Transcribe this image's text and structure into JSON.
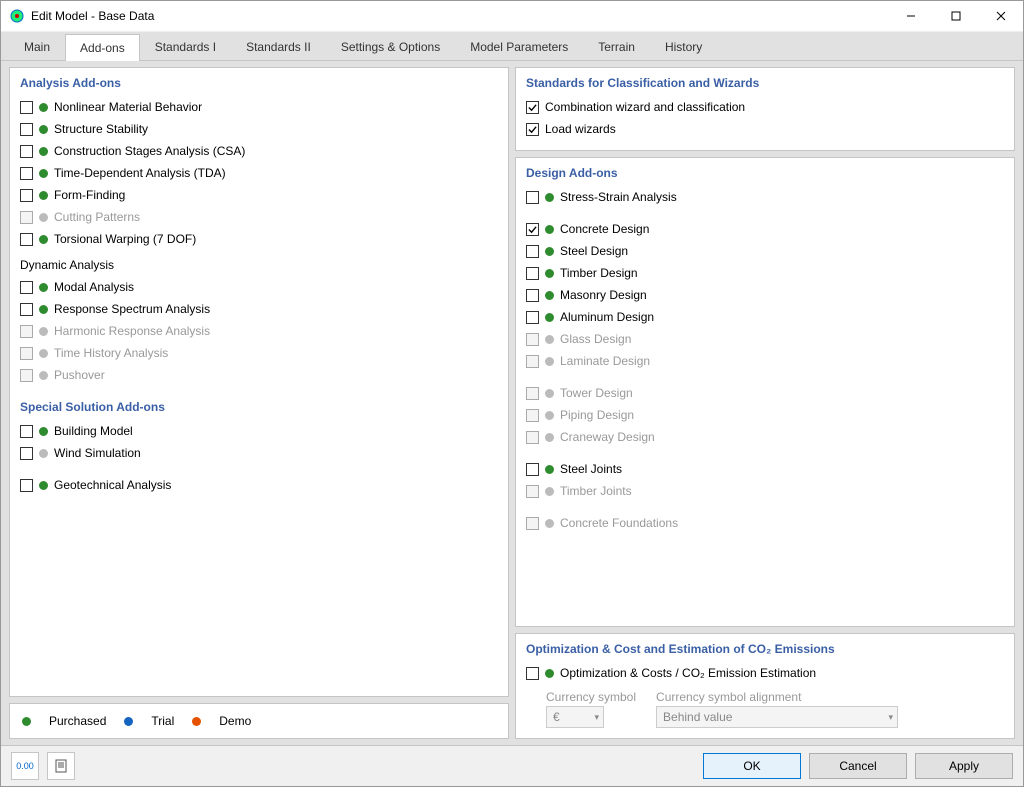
{
  "window": {
    "title": "Edit Model - Base Data"
  },
  "tabs": {
    "t0": "Main",
    "t1": "Add-ons",
    "t2": "Standards I",
    "t3": "Standards II",
    "t4": "Settings & Options",
    "t5": "Model Parameters",
    "t6": "Terrain",
    "t7": "History"
  },
  "sections": {
    "analysis": "Analysis Add-ons",
    "dynamic": "Dynamic Analysis",
    "special": "Special Solution Add-ons",
    "standards_wiz": "Standards for Classification and Wizards",
    "design": "Design Add-ons",
    "optimization": "Optimization & Cost and Estimation of CO₂ Emissions"
  },
  "analysis": {
    "i0": "Nonlinear Material Behavior",
    "i1": "Structure Stability",
    "i2": "Construction Stages Analysis (CSA)",
    "i3": "Time-Dependent Analysis (TDA)",
    "i4": "Form-Finding",
    "i5": "Cutting Patterns",
    "i6": "Torsional Warping (7 DOF)"
  },
  "dynamic": {
    "i0": "Modal Analysis",
    "i1": "Response Spectrum Analysis",
    "i2": "Harmonic Response Analysis",
    "i3": "Time History Analysis",
    "i4": "Pushover"
  },
  "special": {
    "i0": "Building Model",
    "i1": "Wind Simulation",
    "i2": "Geotechnical Analysis"
  },
  "standards_wiz": {
    "i0": "Combination wizard and classification",
    "i1": "Load wizards"
  },
  "design": {
    "i0": "Stress-Strain Analysis",
    "i1": "Concrete Design",
    "i2": "Steel Design",
    "i3": "Timber Design",
    "i4": "Masonry Design",
    "i5": "Aluminum Design",
    "i6": "Glass Design",
    "i7": "Laminate Design",
    "i8": "Tower Design",
    "i9": "Piping Design",
    "i10": "Craneway Design",
    "i11": "Steel Joints",
    "i12": "Timber Joints",
    "i13": "Concrete Foundations"
  },
  "optimization": {
    "i0": "Optimization & Costs / CO₂ Emission Estimation",
    "currency_label": "Currency symbol",
    "currency_value": "€",
    "alignment_label": "Currency symbol alignment",
    "alignment_value": "Behind value"
  },
  "legend": {
    "purchased": "Purchased",
    "trial": "Trial",
    "demo": "Demo"
  },
  "footer": {
    "ok": "OK",
    "cancel": "Cancel",
    "apply": "Apply",
    "units_icon": "0.00"
  }
}
